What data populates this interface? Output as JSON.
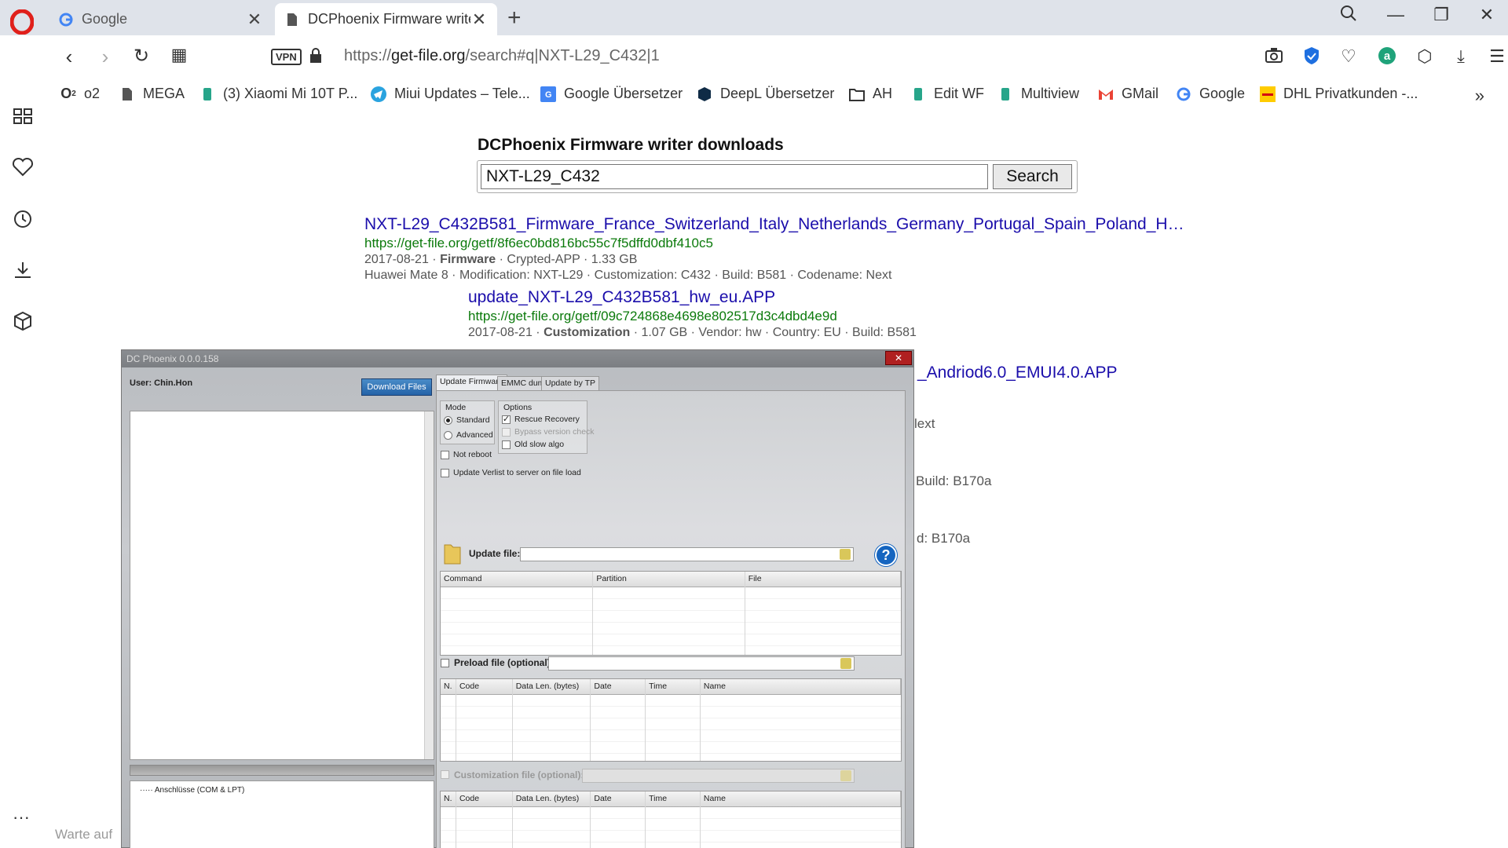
{
  "browser": {
    "tabs": [
      {
        "title": "Google",
        "active": false
      },
      {
        "title": "DCPhoenix Firmware writer",
        "active": true
      }
    ],
    "url_scheme": "https://",
    "url_host": "get-file.org",
    "url_path": "/search#q|NXT-L29_C432|1",
    "vpn_label": "VPN",
    "bookmarks": [
      {
        "label": "o2",
        "icon": "o2-icon"
      },
      {
        "label": "MEGA",
        "icon": "document-icon"
      },
      {
        "label": "(3) Xiaomi Mi 10T P...",
        "icon": "bookmark-icon"
      },
      {
        "label": "Miui Updates – Tele...",
        "icon": "telegram-icon"
      },
      {
        "label": "Google Übersetzer",
        "icon": "google-translate-icon"
      },
      {
        "label": "DeepL Übersetzer",
        "icon": "deepl-icon"
      },
      {
        "label": "AH",
        "icon": "folder-icon"
      },
      {
        "label": "Edit WF",
        "icon": "bookmark-icon"
      },
      {
        "label": "Multiview",
        "icon": "bookmark-icon"
      },
      {
        "label": "GMail",
        "icon": "gmail-icon"
      },
      {
        "label": "Google",
        "icon": "google-icon"
      },
      {
        "label": "DHL Privatkunden -...",
        "icon": "dhl-icon"
      }
    ],
    "status": "Warte auf"
  },
  "page": {
    "heading": "DCPhoenix Firmware writer downloads",
    "search_value": "NXT-L29_C432",
    "search_button": "Search",
    "results": [
      {
        "title": "NXT-L29_C432B581_Firmware_France_Switzerland_Italy_Netherlands_Germany_Portugal_Spain_Poland_H…",
        "url": "https://get-file.org/getf/8f6ec0bd816bc55c7f5dffd0dbf410c5",
        "meta1_date": "2017-08-21",
        "meta1_type": "Firmware",
        "meta1_rest": "Crypted-APP · 1.33 GB",
        "meta2": "Huawei Mate 8 · Modification: NXT-L29 · Customization: C432 · Build: B581 · Codename: Next"
      },
      {
        "title": "update_NXT-L29_C432B581_hw_eu.APP",
        "url": "https://get-file.org/getf/09c724868e4698e802517d3c4dbd4e9d",
        "meta1_date": "2017-08-21",
        "meta1_type": "Customization",
        "meta1_rest": "1.07 GB · Vendor: hw · Country: EU · Build: B581"
      }
    ],
    "partial_texts": {
      "link": "_Andriod6.0_EMUI4.0.APP",
      "codename": "lext",
      "build1": "Build: B170a",
      "build2": "d: B170a"
    }
  },
  "dcphoenix": {
    "title": "DC Phoenix 0.0.0.158",
    "user": "User: Chin.Hon",
    "download_button": "Download Files",
    "tabs": [
      "Update Firmware",
      "EMMC dump",
      "Update by TP"
    ],
    "mode_title": "Mode",
    "mode_standard": "Standard",
    "mode_advanced": "Advanced",
    "options_title": "Options",
    "opt_rescue": "Rescue Recovery",
    "opt_bypass": "Bypass version check",
    "opt_oldslow": "Old slow algo",
    "not_reboot": "Not reboot",
    "update_verlist": "Update Verlist to server on file load",
    "update_file_label": "Update file:",
    "update_cols": [
      "Command",
      "Partition",
      "File"
    ],
    "preload_label": "Preload file (optional):",
    "preload_cols": [
      "N.",
      "Code",
      "Data Len. (bytes)",
      "Date",
      "Time",
      "Name"
    ],
    "custom_label": "Customization file (optional):",
    "custom_cols": [
      "N.",
      "Code",
      "Data Len. (bytes)",
      "Date",
      "Time",
      "Name"
    ],
    "tree_item": "····· Anschlüsse (COM & LPT)",
    "help_glyph": "?"
  }
}
